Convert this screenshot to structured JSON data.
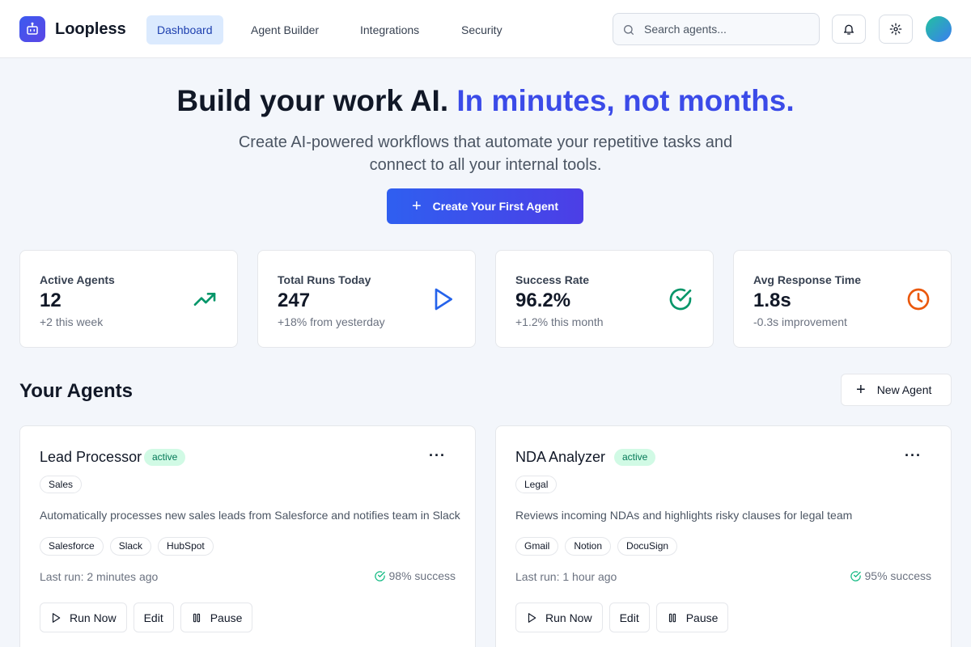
{
  "app": {
    "brand": "Loopless",
    "nav": [
      {
        "label": "Dashboard",
        "active": true
      },
      {
        "label": "Agent Builder",
        "active": false
      },
      {
        "label": "Integrations",
        "active": false
      },
      {
        "label": "Security",
        "active": false
      }
    ],
    "search_placeholder": "Search agents...",
    "header_icons": [
      "bell-icon",
      "gear-icon"
    ]
  },
  "hero": {
    "title_main": "Build your work AI.",
    "title_accent": "In minutes, not months.",
    "subtitle": "Create AI-powered workflows that automate your repetitive tasks and connect to all your internal tools.",
    "cta_label": "Create Your First Agent"
  },
  "stats": [
    {
      "label": "Active Agents",
      "value": "12",
      "sub": "+2 this week",
      "icon": "trending-up-icon",
      "color": "#059669"
    },
    {
      "label": "Total Runs Today",
      "value": "247",
      "sub": "+18% from yesterday",
      "icon": "play-icon",
      "color": "#2563eb"
    },
    {
      "label": "Success Rate",
      "value": "96.2%",
      "sub": "+1.2% this month",
      "icon": "check-circle-icon",
      "color": "#059669"
    },
    {
      "label": "Avg Response Time",
      "value": "1.8s",
      "sub": "-0.3s improvement",
      "icon": "clock-icon",
      "color": "#ea580c"
    }
  ],
  "agents_section": {
    "title": "Your Agents",
    "new_button": "New Agent"
  },
  "agents": [
    {
      "name": "Lead Processor",
      "status": "active",
      "category": "Sales",
      "description": "Automatically processes new sales leads from Salesforce and notifies team in Slack",
      "tags": [
        "Salesforce",
        "Slack",
        "HubSpot"
      ],
      "last_run": "Last run: 2 minutes ago",
      "success": "98% success",
      "actions": {
        "run": "Run Now",
        "edit": "Edit",
        "pause": "Pause"
      }
    },
    {
      "name": "NDA Analyzer",
      "status": "active",
      "category": "Legal",
      "description": "Reviews incoming NDAs and highlights risky clauses for legal team",
      "tags": [
        "Gmail",
        "Notion",
        "DocuSign"
      ],
      "last_run": "Last run: 1 hour ago",
      "success": "95% success",
      "actions": {
        "run": "Run Now",
        "edit": "Edit",
        "pause": "Pause"
      }
    }
  ],
  "colors": {
    "accent": "#3b4be8",
    "status_active_bg": "#d1fae5",
    "status_active_text": "#047857",
    "nav_active_bg": "#dbeafe"
  }
}
